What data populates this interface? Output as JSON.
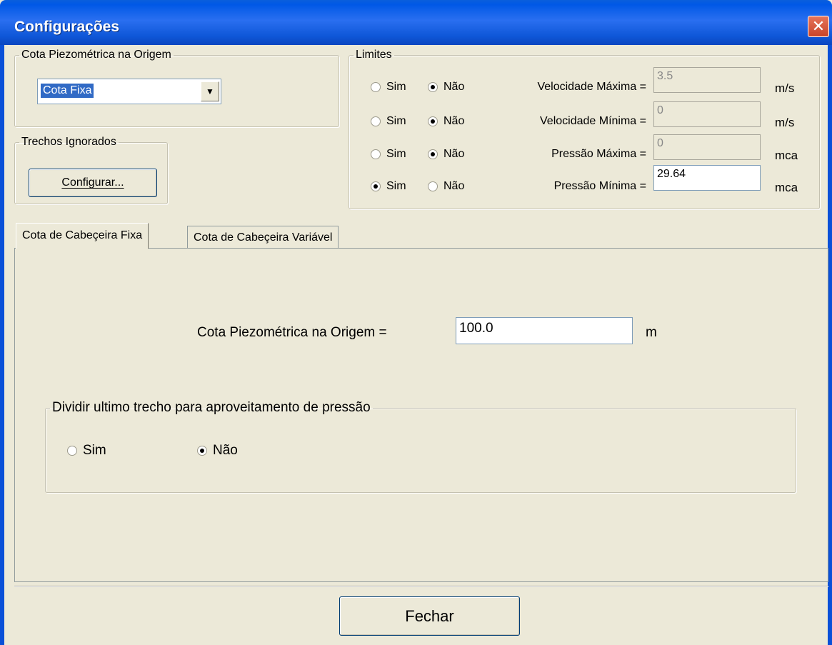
{
  "window": {
    "title": "Configurações",
    "close_glyph": "✕"
  },
  "origin_group": {
    "legend": "Cota Piezométrica na Origem",
    "combo_value": "Cota Fixa",
    "combo_arrow": "▼"
  },
  "ignored_group": {
    "legend": "Trechos Ignorados",
    "button_label": "Configurar..."
  },
  "limits": {
    "legend": "Limites",
    "rows": [
      {
        "sim": "Sim",
        "nao": "Não",
        "selected": "nao",
        "label": "Velocidade Máxima =",
        "value": "3.5",
        "unit": "m/s",
        "enabled": false
      },
      {
        "sim": "Sim",
        "nao": "Não",
        "selected": "nao",
        "label": "Velocidade Mínima =",
        "value": "0",
        "unit": "m/s",
        "enabled": false
      },
      {
        "sim": "Sim",
        "nao": "Não",
        "selected": "nao",
        "label": "Pressão Máxima =",
        "value": "0",
        "unit": "mca",
        "enabled": false
      },
      {
        "sim": "Sim",
        "nao": "Não",
        "selected": "sim",
        "label": "Pressão Mínima =",
        "value": "29.64",
        "unit": "mca",
        "enabled": true
      }
    ]
  },
  "tabs": [
    {
      "label": "Cota de Cabeçeira Fixa",
      "active": true
    },
    {
      "label": "Cota de Cabeçeira Variável",
      "active": false
    }
  ],
  "fixed_tab": {
    "cota_label": "Cota Piezométrica na Origem =",
    "cota_value": "100.0",
    "cota_unit": "m",
    "divide_group": {
      "legend": "Dividir ultimo trecho para aproveitamento de pressão",
      "sim": "Sim",
      "nao": "Não",
      "selected": "nao"
    }
  },
  "footer": {
    "close_button": "Fechar"
  },
  "colors": {
    "title_bar": "#0a5fdc",
    "dialog_bg": "#ece9d8",
    "close_red": "#d8583c"
  }
}
